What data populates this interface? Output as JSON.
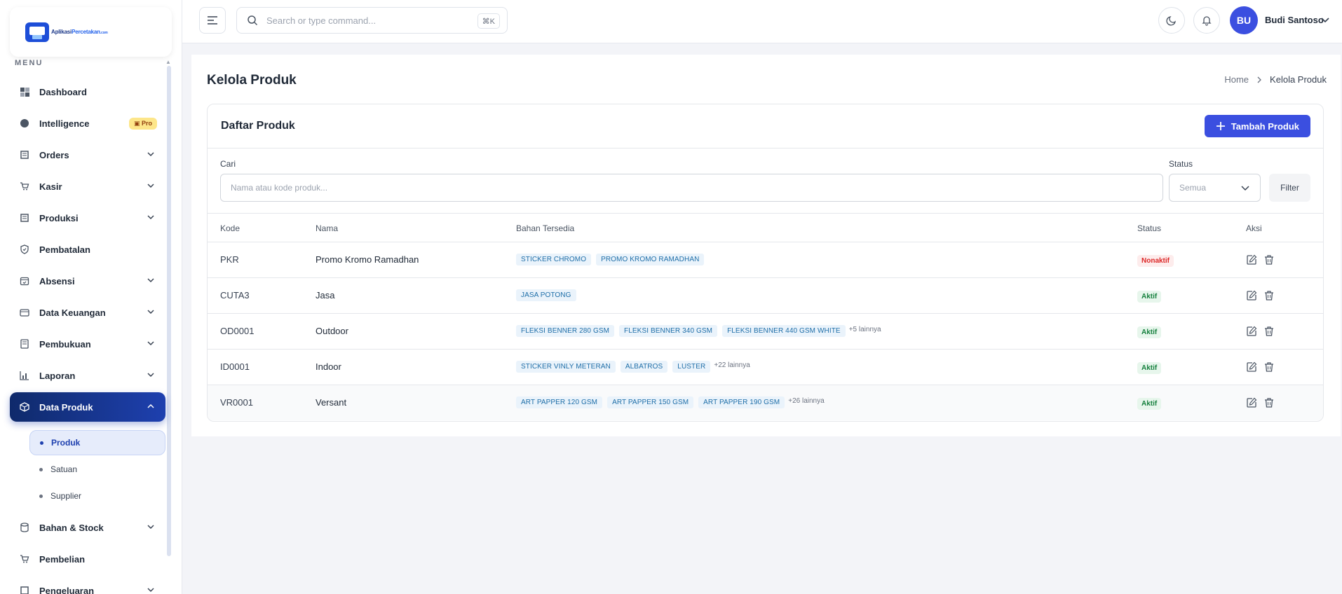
{
  "app": {
    "logo_text": "Aplikasi",
    "logo_accent": "Percetakan",
    "logo_suffix": ".com"
  },
  "sidebar": {
    "menu_label": "MENU",
    "items": [
      {
        "label": "Dashboard",
        "icon": "dashboard-icon"
      },
      {
        "label": "Intelligence",
        "icon": "brain-icon",
        "badge": "Pro"
      },
      {
        "label": "Orders",
        "icon": "orders-icon"
      },
      {
        "label": "Kasir",
        "icon": "cart-icon"
      },
      {
        "label": "Produksi",
        "icon": "production-icon"
      },
      {
        "label": "Pembatalan",
        "icon": "shield-icon"
      },
      {
        "label": "Absensi",
        "icon": "calendar-check-icon"
      },
      {
        "label": "Data Keuangan",
        "icon": "wallet-icon"
      },
      {
        "label": "Pembukuan",
        "icon": "book-icon"
      },
      {
        "label": "Laporan",
        "icon": "bar-chart-icon"
      },
      {
        "label": "Data Produk",
        "icon": "box-icon"
      },
      {
        "label": "Bahan & Stock",
        "icon": "database-icon"
      },
      {
        "label": "Pembelian",
        "icon": "cart-icon"
      },
      {
        "label": "Pengeluaran",
        "icon": "receipt-icon"
      }
    ],
    "sub_items": [
      {
        "label": "Produk"
      },
      {
        "label": "Satuan"
      },
      {
        "label": "Supplier"
      }
    ]
  },
  "topbar": {
    "search_placeholder": "Search or type command...",
    "shortcut": "⌘K",
    "avatar_initials": "BU",
    "user_name": "Budi Santoso"
  },
  "page": {
    "title": "Kelola Produk",
    "breadcrumb_home": "Home",
    "breadcrumb_current": "Kelola Produk"
  },
  "card": {
    "title": "Daftar Produk",
    "add_button": "Tambah Produk",
    "search_label": "Cari",
    "search_placeholder": "Nama atau kode produk...",
    "status_label": "Status",
    "status_value": "Semua",
    "filter_button": "Filter"
  },
  "table": {
    "headers": {
      "kode": "Kode",
      "nama": "Nama",
      "bahan": "Bahan Tersedia",
      "status": "Status",
      "aksi": "Aksi"
    },
    "rows": [
      {
        "kode": "PKR",
        "nama": "Promo Kromo Ramadhan",
        "chips": [
          "STICKER CHROMO",
          "PROMO KROMO RAMADHAN"
        ],
        "more": "",
        "status": "Nonaktif"
      },
      {
        "kode": "CUTA3",
        "nama": "Jasa",
        "chips": [
          "JASA POTONG"
        ],
        "more": "",
        "status": "Aktif"
      },
      {
        "kode": "OD0001",
        "nama": "Outdoor",
        "chips": [
          "FLEKSI BENNER 280 GSM",
          "FLEKSI BENNER 340 GSM",
          "FLEKSI BENNER 440 GSM WHITE"
        ],
        "more": "+5 lainnya",
        "status": "Aktif"
      },
      {
        "kode": "ID0001",
        "nama": "Indoor",
        "chips": [
          "STICKER VINLY METERAN",
          "ALBATROS",
          "LUSTER"
        ],
        "more": "+22 lainnya",
        "status": "Aktif"
      },
      {
        "kode": "VR0001",
        "nama": "Versant",
        "chips": [
          "ART PAPPER 120 GSM",
          "ART PAPPER 150 GSM",
          "ART PAPPER 190 GSM"
        ],
        "more": "+26 lainnya",
        "status": "Aktif"
      }
    ]
  },
  "colors": {
    "primary": "#3b4fe0",
    "active_nav": "#1e40af",
    "chip_text": "#1e6ea8",
    "aktif": "#15803d",
    "nonaktif": "#dc2626"
  }
}
